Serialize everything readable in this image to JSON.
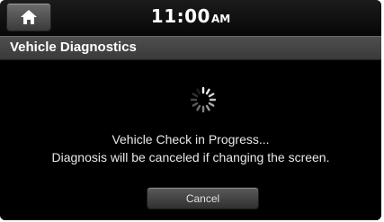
{
  "status_bar": {
    "home_icon": "home-icon",
    "time": "11:00",
    "ampm": "AM"
  },
  "header": {
    "title": "Vehicle Diagnostics"
  },
  "main": {
    "spinner_icon": "loading-spinner-icon",
    "message_line1": "Vehicle Check in Progress...",
    "message_line2": "Diagnosis will be canceled if changing the screen.",
    "cancel_label": "Cancel"
  },
  "colors": {
    "background": "#000000",
    "title_bar": "#444444",
    "text": "#ffffff"
  }
}
